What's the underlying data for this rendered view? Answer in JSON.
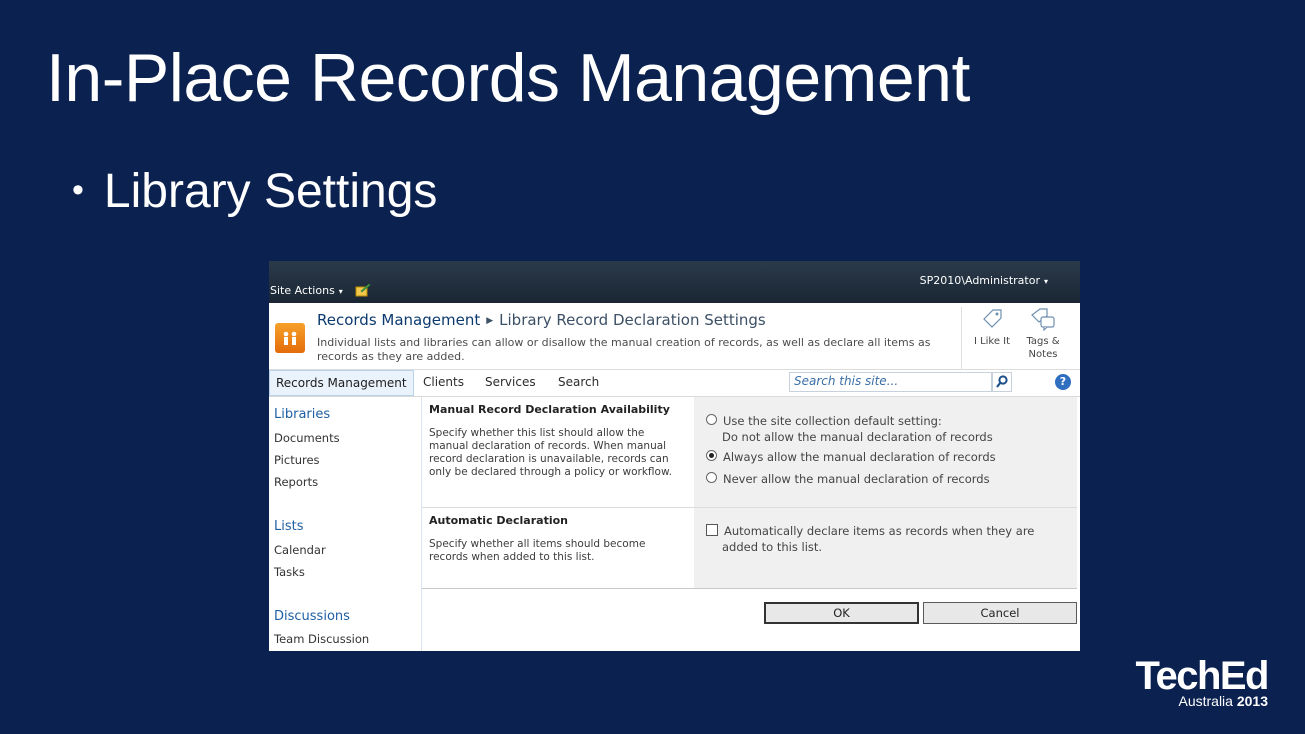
{
  "slide": {
    "title": "In-Place Records Management",
    "bullet": "Library Settings"
  },
  "sharepoint": {
    "top_bar": {
      "site_actions": "Site Actions",
      "user": "SP2010\\Administrator"
    },
    "breadcrumb": {
      "site": "Records Management",
      "page": "Library Record Declaration Settings"
    },
    "description": "Individual lists and libraries can allow or disallow the manual creation of records, as well as declare all items as records as they are added.",
    "social": {
      "like": "I Like It",
      "tags_line1": "Tags &",
      "tags_line2": "Notes"
    },
    "top_nav": [
      "Records Management",
      "Clients",
      "Services",
      "Search"
    ],
    "search": {
      "placeholder": "Search this site..."
    },
    "help_label": "?",
    "quick_launch": {
      "libraries": {
        "heading": "Libraries",
        "items": [
          "Documents",
          "Pictures",
          "Reports"
        ]
      },
      "lists": {
        "heading": "Lists",
        "items": [
          "Calendar",
          "Tasks"
        ]
      },
      "discussions": {
        "heading": "Discussions",
        "items": [
          "Team Discussion"
        ]
      }
    },
    "manual_declaration": {
      "title": "Manual Record Declaration Availability",
      "description": "Specify whether this list should allow the manual declaration of records.  When manual record declaration is unavailable, records can only be declared through a policy or workflow.",
      "options": [
        "Use the site collection default setting:",
        "Do not allow the manual declaration of records",
        "Always allow the manual declaration of records",
        "Never allow the manual declaration of records"
      ],
      "selected": "Always allow the manual declaration of records"
    },
    "automatic_declaration": {
      "title": "Automatic Declaration",
      "description": "Specify whether all items should become records when added to this list.",
      "checkbox_line1": "Automatically declare items as records when they are",
      "checkbox_line2": "added to this list.",
      "checked": false
    },
    "buttons": {
      "ok": "OK",
      "cancel": "Cancel"
    }
  },
  "branding": {
    "name": "TechEd",
    "region": "Australia",
    "year": "2013"
  },
  "colors": {
    "slide_background": "#0b2150",
    "link_blue": "#1f5fa3",
    "logo_orange": "#e36c0a"
  }
}
